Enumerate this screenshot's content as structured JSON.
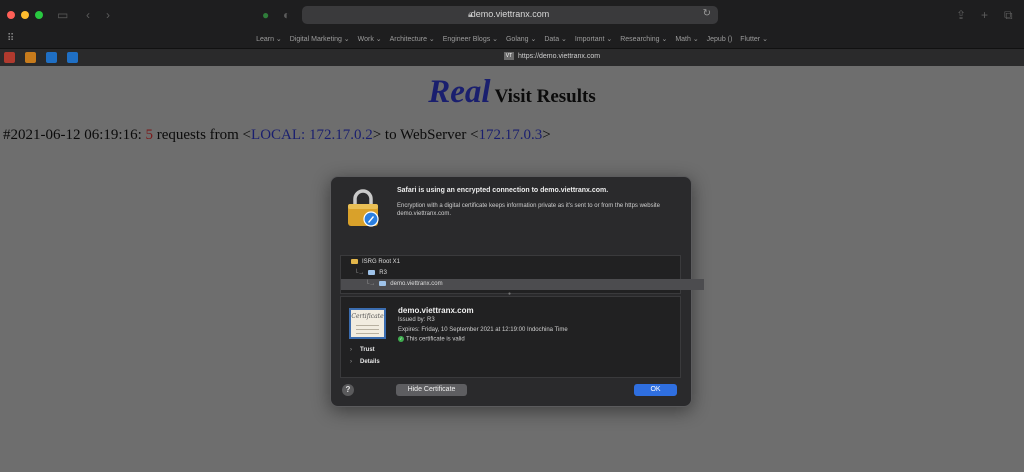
{
  "browser": {
    "url": "demo.viettranx.com",
    "favorites": [
      "Learn ⌄",
      "Digital Marketing ⌄",
      "Work ⌄",
      "Architecture ⌄",
      "Engineer Blogs ⌄",
      "Golang ⌄",
      "Data ⌄",
      "Important ⌄",
      "Researching ⌄",
      "Math ⌄",
      "Jepub ()",
      "Flutter ⌄"
    ],
    "active_tab": {
      "favicon_text": "VT",
      "title": "https://demo.viettranx.com"
    }
  },
  "page": {
    "heading_em": "Real",
    "heading_rest": "Visit Results",
    "log": {
      "prefix": "#2021-06-12 06:19:16: ",
      "count": "5",
      "mid1": " requests from <",
      "local": "LOCAL: 172.17.0.2",
      "mid2": "> to WebServer <",
      "server": "172.17.0.3",
      "suffix": ">"
    }
  },
  "dialog": {
    "title": "Safari is using an encrypted connection to demo.viettranx.com.",
    "description": "Encryption with a digital certificate keeps information private as it's sent to or from the https website demo.viettranx.com.",
    "chain": [
      {
        "prefix": "",
        "label": "ISRG Root X1"
      },
      {
        "prefix": "└→",
        "label": "R3"
      },
      {
        "prefix": "└→",
        "label": "demo.viettranx.com"
      }
    ],
    "details": {
      "name": "demo.viettranx.com",
      "issued_by": "Issued by: R3",
      "expires": "Expires: Friday, 10 September 2021 at 12:19:00 Indochina Time",
      "status": "This certificate is valid",
      "cert_image_text": "Certificate",
      "trust_label": "Trust",
      "details_label": "Details"
    },
    "buttons": {
      "help": "?",
      "hide": "Hide Certificate",
      "ok": "OK"
    }
  },
  "colors": {
    "ok_button": "#2f6fe0",
    "heading_blue": "#1a1f6e",
    "request_count_red": "#7a1a1a",
    "valid_green": "#3fae4f"
  }
}
